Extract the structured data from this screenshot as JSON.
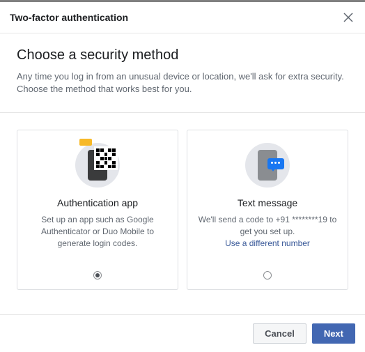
{
  "header": {
    "title": "Two-factor authentication"
  },
  "intro": {
    "title": "Choose a security method",
    "desc": "Any time you log in from an unusual device or location, we'll ask for extra security. Choose the method that works best for you."
  },
  "options": {
    "app": {
      "title": "Authentication app",
      "desc": "Set up an app such as Google Authenticator or Duo Mobile to generate login codes.",
      "selected": true
    },
    "sms": {
      "title": "Text message",
      "desc": "We'll send a code to +91 ********19 to get you set up.",
      "link": "Use a different number",
      "selected": false
    }
  },
  "footer": {
    "cancel": "Cancel",
    "next": "Next"
  }
}
